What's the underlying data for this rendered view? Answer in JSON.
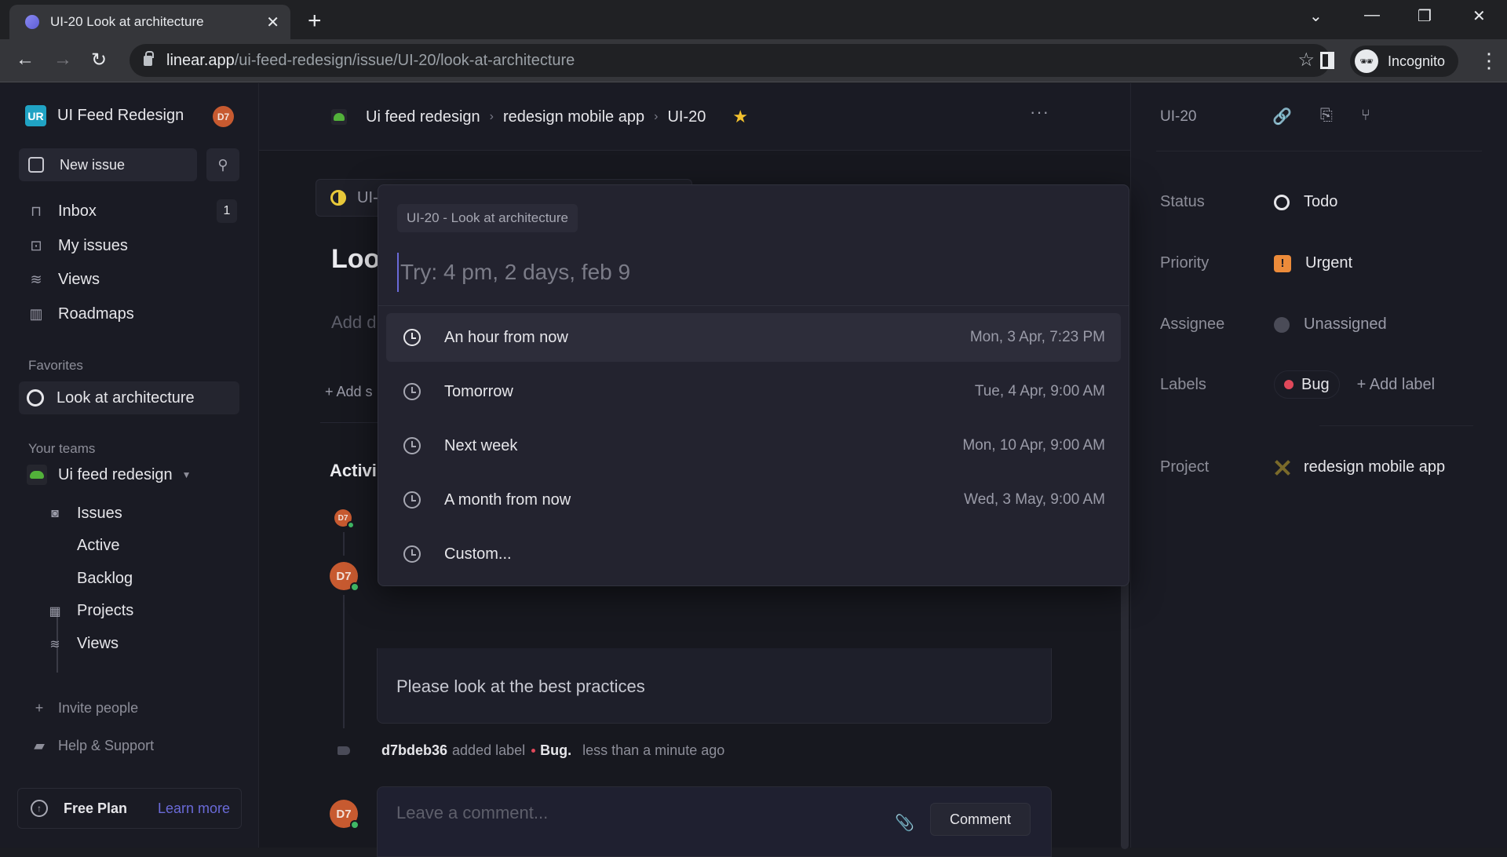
{
  "browser": {
    "tab_title": "UI-20 Look at architecture",
    "url_host": "linear.app",
    "url_path": "/ui-feed-redesign/issue/UI-20/look-at-architecture",
    "profile_label": "Incognito"
  },
  "sidebar": {
    "workspace_initials": "UR",
    "workspace_name": "UI Feed Redesign",
    "user_initials": "D7",
    "new_issue_label": "New issue",
    "nav": [
      {
        "label": "Inbox",
        "icon": "inbox-icon",
        "badge": "1"
      },
      {
        "label": "My issues",
        "icon": "target-icon"
      },
      {
        "label": "Views",
        "icon": "layers-icon"
      },
      {
        "label": "Roadmaps",
        "icon": "map-icon"
      }
    ],
    "favorites_heading": "Favorites",
    "favorites": [
      {
        "label": "Look at architecture"
      }
    ],
    "teams_heading": "Your teams",
    "team": {
      "name": "Ui feed redesign",
      "items": [
        {
          "label": "Issues"
        },
        {
          "label": "Active"
        },
        {
          "label": "Backlog"
        },
        {
          "label": "Projects"
        },
        {
          "label": "Views"
        }
      ]
    },
    "invite_label": "Invite people",
    "help_label": "Help & Support",
    "plan_label": "Free Plan",
    "learn_more_label": "Learn more"
  },
  "header": {
    "breadcrumb": [
      "Ui feed redesign",
      "redesign mobile app",
      "UI-20"
    ],
    "starred": true
  },
  "issue": {
    "parent_chip": "UI-",
    "title_visible": "Loo",
    "description_placeholder": "Add d",
    "add_sub_label": "+ Add s",
    "activity_heading": "Activi",
    "comment_text": "Please look at the best practices",
    "label_event": {
      "user": "d7bdeb36",
      "action": "added label",
      "label": "Bug.",
      "time": "less than a minute ago"
    },
    "comment_placeholder": "Leave a comment...",
    "comment_button": "Comment"
  },
  "right_panel": {
    "issue_id": "UI-20",
    "properties": {
      "status_label": "Status",
      "status_value": "Todo",
      "priority_label": "Priority",
      "priority_value": "Urgent",
      "assignee_label": "Assignee",
      "assignee_value": "Unassigned",
      "labels_label": "Labels",
      "label_value": "Bug",
      "add_label": "+ Add label",
      "project_label": "Project",
      "project_value": "redesign mobile app"
    }
  },
  "snooze_popup": {
    "context_chip": "UI-20 - Look at architecture",
    "input_placeholder": "Try: 4 pm, 2 days, feb 9",
    "input_value": "",
    "options": [
      {
        "label": "An hour from now",
        "when": "Mon, 3 Apr, 7:23 PM",
        "highlighted": true
      },
      {
        "label": "Tomorrow",
        "when": "Tue, 4 Apr, 9:00 AM"
      },
      {
        "label": "Next week",
        "when": "Mon, 10 Apr, 9:00 AM"
      },
      {
        "label": "A month from now",
        "when": "Wed, 3 May, 9:00 AM"
      },
      {
        "label": "Custom...",
        "when": ""
      }
    ]
  },
  "colors": {
    "accent": "#6a6ad8",
    "urgent": "#ec8b3a",
    "bug": "#e0485a",
    "team": "#52b13a",
    "star": "#f2c12e"
  }
}
